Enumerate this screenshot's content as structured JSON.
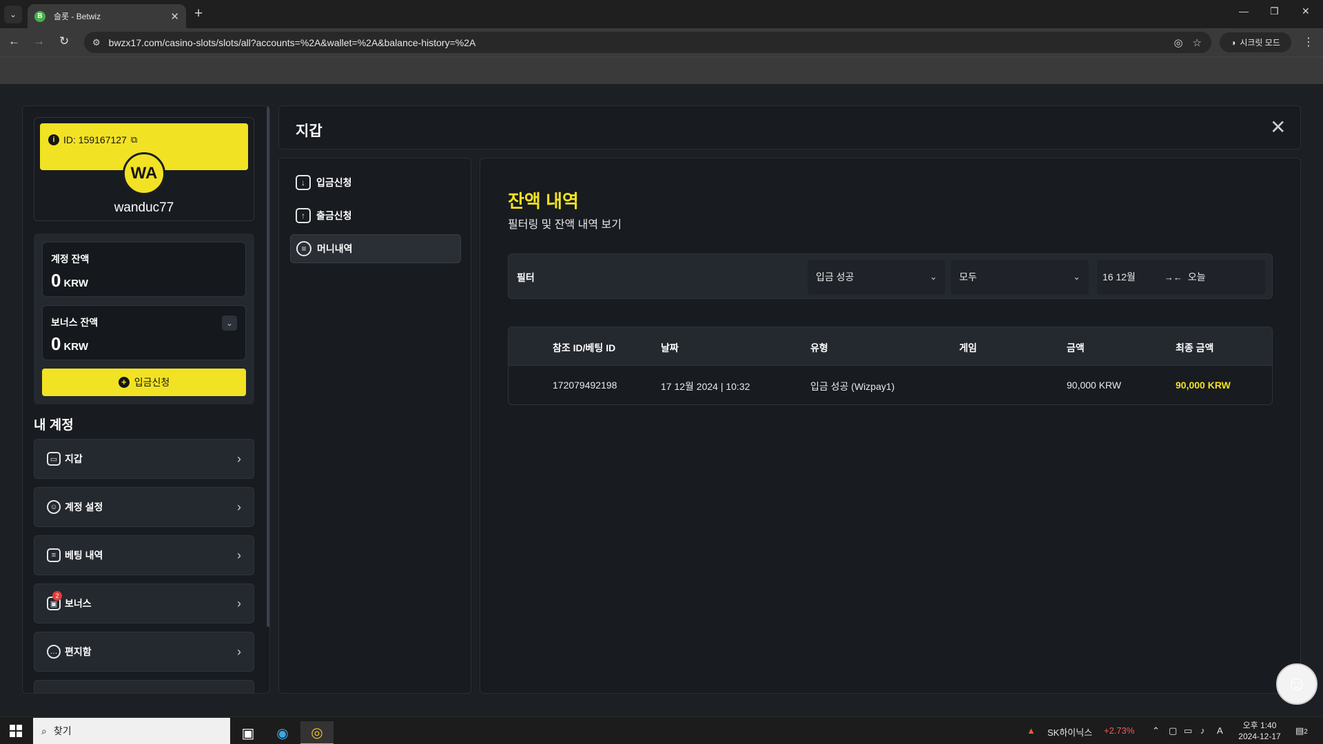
{
  "browser": {
    "tab_title": "슬롯 - Betwiz",
    "favicon_letter": "B",
    "url": "bwzx17.com/casino-slots/slots/all?accounts=%2A&wallet=%2A&balance-history=%2A",
    "incognito_label": "시크릿 모드"
  },
  "profile": {
    "id_label": "ID: 159167127",
    "avatar_initials": "WA",
    "username": "wanduc77"
  },
  "balances": {
    "account_label": "계정 잔액",
    "account_value": "0",
    "account_unit": "KRW",
    "bonus_label": "보너스 잔액",
    "bonus_value": "0",
    "bonus_unit": "KRW",
    "deposit_button": "입금신청"
  },
  "my_account": {
    "title": "내 계정",
    "items": [
      {
        "label": "지갑",
        "icon": "wallet-icon"
      },
      {
        "label": "계정 설정",
        "icon": "user-settings-icon"
      },
      {
        "label": "베팅 내역",
        "icon": "receipt-icon"
      },
      {
        "label": "보너스",
        "icon": "gift-icon",
        "badge": "2"
      },
      {
        "label": "편지함",
        "icon": "message-icon"
      }
    ]
  },
  "wallet": {
    "title": "지갑",
    "nav": [
      {
        "label": "입금신청",
        "icon": "download-icon"
      },
      {
        "label": "출금신청",
        "icon": "upload-icon"
      },
      {
        "label": "머니내역",
        "icon": "history-icon",
        "active": true
      }
    ],
    "history": {
      "title": "잔액 내역",
      "subtitle": "필터링 및 잔액 내역 보기",
      "filter_label": "필터",
      "type_filter": "입금 성공",
      "status_filter": "모두",
      "date_from": "16 12월",
      "date_to": "오늘",
      "columns": [
        "참조 ID/베팅 ID",
        "날짜",
        "유형",
        "게임",
        "금액",
        "최종 금액"
      ],
      "rows": [
        [
          "172079492198",
          "17 12월 2024 | 10:32",
          "입금 성공 (Wizpay1)",
          "",
          "90,000 KRW",
          "90,000 KRW"
        ]
      ]
    }
  },
  "taskbar": {
    "search_label": "찾기",
    "stock_name": "SK하이닉스",
    "stock_change": "+2.73%",
    "ime": "A",
    "time": "오후 1:40",
    "date": "2024-12-17",
    "notifications": "2"
  },
  "colors": {
    "accent_yellow": "#f2e224",
    "panel_bg": "#181b20",
    "card_bg": "#24282f"
  }
}
